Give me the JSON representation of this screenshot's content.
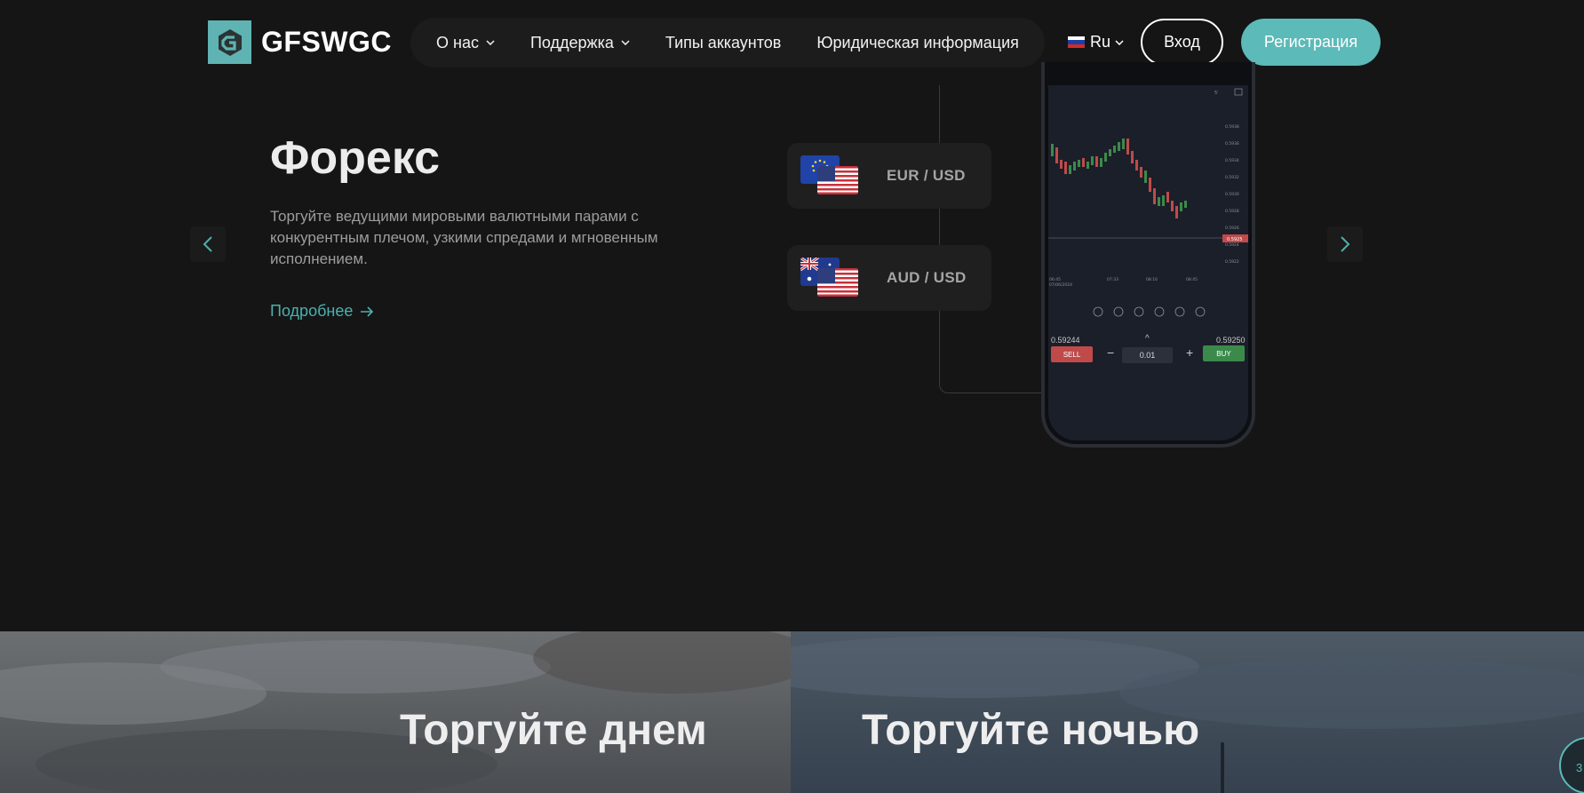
{
  "brand": {
    "name": "GFSWGC",
    "accent_color": "#5cbab8"
  },
  "nav": {
    "items": [
      {
        "label": "О нас",
        "has_dropdown": true
      },
      {
        "label": "Поддержка",
        "has_dropdown": true
      },
      {
        "label": "Типы аккаунтов",
        "has_dropdown": false
      },
      {
        "label": "Юридическая информация",
        "has_dropdown": false
      }
    ],
    "language": "Ru",
    "login_label": "Вход",
    "register_label": "Регистрация"
  },
  "hero": {
    "title": "Форекс",
    "description": "Торгуйте ведущими мировыми валютными парами с конкурентным плечом, узкими спредами и мгновенным исполнением.",
    "more_label": "Подробнее",
    "pairs": [
      {
        "label": "EUR / USD",
        "base_flag": "eu-flag",
        "quote_flag": "us-flag"
      },
      {
        "label": "AUD / USD",
        "base_flag": "au-flag",
        "quote_flag": "us-flag"
      }
    ]
  },
  "phone": {
    "top_icons": [
      "5'",
      "candle-icon",
      "tools-icon"
    ],
    "price_scale": [
      "0.5938",
      "0.5936",
      "0.5934",
      "0.5932",
      "0.5930",
      "0.5928",
      "0.5926",
      "0.5924",
      "0.5922"
    ],
    "current_price_tag": "0.5925",
    "time_labels": [
      "06:45",
      "07:33",
      "08:16",
      "08:45"
    ],
    "date_label": "07/06/2024",
    "sell_price": "0.59244",
    "buy_price": "0.59250",
    "sell_label": "SELL",
    "buy_label": "BUY",
    "lot_value": "0.01",
    "minus": "−",
    "plus": "+"
  },
  "banners": {
    "day_title": "Торгуйте днем",
    "night_title": "Торгуйте ночью"
  },
  "chat": {
    "partial_text": "3"
  }
}
